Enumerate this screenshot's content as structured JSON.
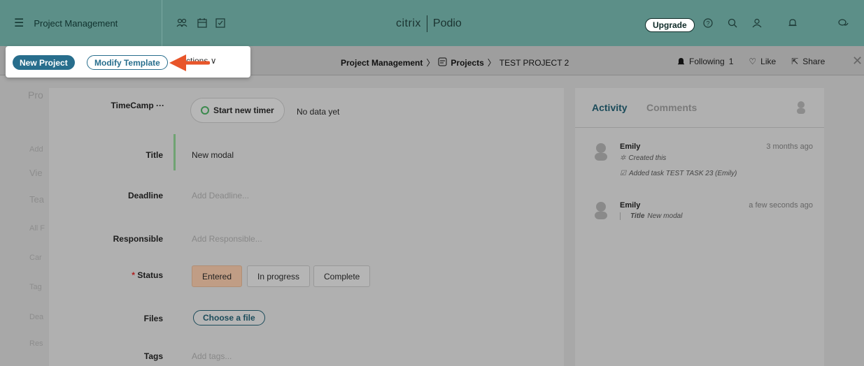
{
  "topbar": {
    "workspace": "Project Management",
    "brand_citrix": "citrix",
    "brand_podio": "Podio",
    "upgrade": "Upgrade"
  },
  "popup": {
    "new_project": "New Project",
    "modify_template": "Modify Template",
    "actions_fragment": "ctions"
  },
  "breadcrumb": {
    "app": "Project Management",
    "projects": "Projects",
    "item": "TEST PROJECT 2"
  },
  "item_actions": {
    "following": "Following",
    "following_count": "1",
    "like": "Like",
    "share": "Share"
  },
  "form": {
    "timecamp_label": "TimeCamp",
    "timer_button": "Start new timer",
    "timer_status": "No data yet",
    "title_label": "Title",
    "title_value": "New modal",
    "deadline_label": "Deadline",
    "deadline_placeholder": "Add Deadline...",
    "responsible_label": "Responsible",
    "responsible_placeholder": "Add Responsible...",
    "status_label": "Status",
    "status_required": "*",
    "status_options": [
      "Entered",
      "In progress",
      "Complete"
    ],
    "status_selected": "Entered",
    "files_label": "Files",
    "files_button": "Choose a file",
    "tags_label": "Tags",
    "tags_placeholder": "Add tags..."
  },
  "activity": {
    "tab_activity": "Activity",
    "tab_comments": "Comments",
    "entries": [
      {
        "name": "Emily",
        "time": "3 months ago",
        "lines": [
          "Created this",
          "Added task TEST TASK 23 (Emily)"
        ]
      },
      {
        "name": "Emily",
        "time": "a few seconds ago",
        "field": "Title",
        "value": "New modal"
      }
    ]
  },
  "colors": {
    "topbar": "#5c8f88",
    "primary": "#286e8d",
    "arrow": "#e8552a",
    "status_selected": "#c09d85"
  }
}
